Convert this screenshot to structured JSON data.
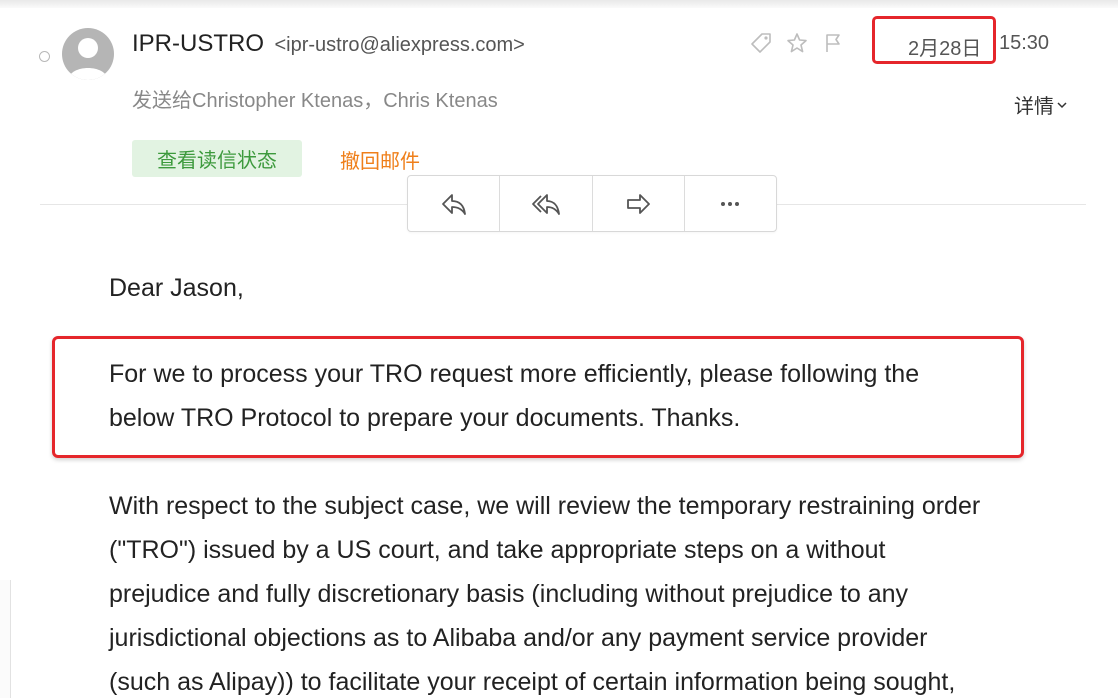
{
  "email": {
    "sender_name": "IPR-USTRO",
    "sender_email": "<ipr-ustro@aliexpress.com>",
    "sent_to_label": "发送给",
    "recipients": "Christopher Ktenas，Chris Ktenas",
    "date": "2月28日",
    "time": "15:30",
    "details_label": "详情",
    "read_status_label": "查看读信状态",
    "recall_label": "撤回邮件"
  },
  "header_icons": [
    "tag-icon",
    "star-icon",
    "flag-icon"
  ],
  "actions": [
    {
      "name": "reply-button",
      "icon": "reply-icon"
    },
    {
      "name": "reply-all-button",
      "icon": "reply-all-icon"
    },
    {
      "name": "forward-button",
      "icon": "forward-icon"
    },
    {
      "name": "more-button",
      "icon": "more-icon"
    }
  ],
  "body": {
    "greeting": "Dear Jason,",
    "para1_lines": [
      "For we to process your TRO request more efficiently, please following the",
      "below TRO Protocol to prepare your documents. Thanks."
    ],
    "para2_lines": [
      "With respect to the subject case, we will review the temporary restraining order",
      "(\"TRO\") issued by a US court, and take appropriate steps on a without",
      "prejudice and fully discretionary basis (including without prejudice to any",
      "jurisdictional objections as to Alibaba and/or any payment service provider",
      "(such as Alipay)) to facilitate your receipt of certain information being sought,"
    ]
  },
  "colors": {
    "highlight": "#e5262b",
    "read_status_bg": "#e2f3e2",
    "read_status_text": "#3d9a3d",
    "recall_text": "#ef7f1a"
  }
}
